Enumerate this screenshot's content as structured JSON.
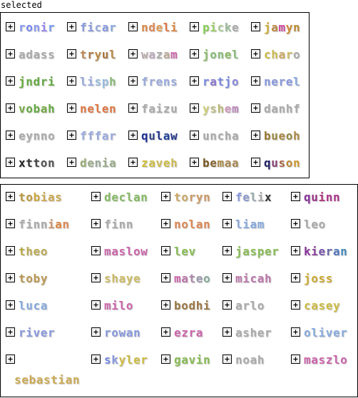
{
  "header": {
    "title": "selected"
  },
  "selected": [
    {
      "name": "ronir",
      "colors": [
        "#8899ee",
        "#7788ee",
        "#8899ee",
        "#9988ee",
        "#7799ee"
      ]
    },
    {
      "name": "ficar",
      "colors": [
        "#8899dd",
        "#8899dd",
        "#99aadd",
        "#8899dd",
        "#88aadd"
      ]
    },
    {
      "name": "ndeli",
      "colors": [
        "#dd8844",
        "#dd8855",
        "#dd9955",
        "#dd7744",
        "#dd8844"
      ]
    },
    {
      "name": "picke",
      "colors": [
        "#88cc55",
        "#99cc66",
        "#aacc99",
        "#99bb99",
        "#aaaaaa"
      ]
    },
    {
      "name": "jamyn",
      "colors": [
        "#ccaa33",
        "#bb8844",
        "#cc4499",
        "#cc8833",
        "#bb8833"
      ]
    },
    {
      "name": "adass",
      "colors": [
        "#aaaaaa",
        "#aaaaaa",
        "#aaaaaa",
        "#aaaaaa",
        "#aaaaaa"
      ]
    },
    {
      "name": "tryul",
      "colors": [
        "#bb8855",
        "#aa7744",
        "#bb8844",
        "#aa7744",
        "#bb8844"
      ]
    },
    {
      "name": "wazam",
      "colors": [
        "#bbaaaa",
        "#bbaabb",
        "#aaaaaa",
        "#bbaa99",
        "#cc66aa"
      ]
    },
    {
      "name": "jonel",
      "colors": [
        "#88bb66",
        "#88bb77",
        "#88bb77",
        "#88bb66",
        "#88bb77"
      ]
    },
    {
      "name": "charo",
      "colors": [
        "#ccbb44",
        "#ccbb55",
        "#ccaa66",
        "#ccbb66",
        "#aaaaaa"
      ]
    },
    {
      "name": "jndri",
      "colors": [
        "#66aa33",
        "#66aa44",
        "#66aa44",
        "#66aa44",
        "#66aa44"
      ]
    },
    {
      "name": "lisph",
      "colors": [
        "#99aadd",
        "#99aadd",
        "#99bbdd",
        "#99bbdd",
        "#88bb77"
      ]
    },
    {
      "name": "frens",
      "colors": [
        "#99aadd",
        "#99aadd",
        "#99aadd",
        "#99aadd",
        "#99aadd"
      ]
    },
    {
      "name": "ratjo",
      "colors": [
        "#7788dd",
        "#8877cc",
        "#7788dd",
        "#7788dd",
        "#8888dd"
      ]
    },
    {
      "name": "nerel",
      "colors": [
        "#8899dd",
        "#8899dd",
        "#8899dd",
        "#8899dd",
        "#88aadd"
      ]
    },
    {
      "name": "vobah",
      "colors": [
        "#77aa44",
        "#66aa44",
        "#66aa44",
        "#77aa44",
        "#66aa44"
      ]
    },
    {
      "name": "nelen",
      "colors": [
        "#dd7744",
        "#dd7744",
        "#dd7744",
        "#dd7744",
        "#dd7744"
      ]
    },
    {
      "name": "faizu",
      "colors": [
        "#aaaaaa",
        "#aaaaaa",
        "#aaaaaa",
        "#aaaaaa",
        "#aaaaaa"
      ]
    },
    {
      "name": "yshem",
      "colors": [
        "#cccc77",
        "#bbbb88",
        "#bbbb77",
        "#cc99bb",
        "#bb88bb"
      ]
    },
    {
      "name": "danhf",
      "colors": [
        "#aaaaaa",
        "#aaaaaa",
        "#aaaaaa",
        "#aaaaaa",
        "#aaaaaa"
      ]
    },
    {
      "name": "eynno",
      "colors": [
        "#aaaaaa",
        "#aaaaaa",
        "#aaaaaa",
        "#aaaaaa",
        "#aaaaaa"
      ]
    },
    {
      "name": "fffar",
      "colors": [
        "#99aadd",
        "#99aadd",
        "#99aadd",
        "#99aadd",
        "#99aadd"
      ]
    },
    {
      "name": "qulaw",
      "colors": [
        "#223399",
        "#334488",
        "#223388",
        "#224499",
        "#223388"
      ]
    },
    {
      "name": "uncha",
      "colors": [
        "#aaaaaa",
        "#aaaaaa",
        "#aaaaaa",
        "#aaaaaa",
        "#aaaaaa"
      ]
    },
    {
      "name": "bueoh",
      "colors": [
        "#997733",
        "#998844",
        "#aa8844",
        "#998844",
        "#aa8844"
      ]
    },
    {
      "name": "xtton",
      "colors": [
        "#222222",
        "#333333",
        "#444444",
        "#555555",
        "#555555"
      ]
    },
    {
      "name": "denia",
      "colors": [
        "#99aa77",
        "#99aa88",
        "#99aa99",
        "#99aa88",
        "#99aa88"
      ]
    },
    {
      "name": "zaveh",
      "colors": [
        "#ccbb33",
        "#ccbb44",
        "#ccbb55",
        "#ccbb44",
        "#ccbb55"
      ]
    },
    {
      "name": "bemaa",
      "colors": [
        "#775522",
        "#886633",
        "#aa8844",
        "#aa8855",
        "#aa8855"
      ]
    },
    {
      "name": "quson",
      "colors": [
        "#222266",
        "#884477",
        "#aa6644",
        "#bb8833",
        "#cc9933"
      ]
    }
  ],
  "available": [
    {
      "name": "tobias",
      "colors": [
        "#bb9944",
        "#bb9944",
        "#ccaa44",
        "#ccaa55",
        "#ccaa55",
        "#ccaa55"
      ]
    },
    {
      "name": "declan",
      "colors": [
        "#88bb66",
        "#88bb66",
        "#88bb66",
        "#88bb66",
        "#88bb66",
        "#88bb66"
      ]
    },
    {
      "name": "toryn",
      "colors": [
        "#ccaa66",
        "#ccaa66",
        "#cc9966",
        "#cc9966",
        "#cc9966"
      ]
    },
    {
      "name": "felix",
      "colors": [
        "#8899dd",
        "#8899cc",
        "#99aaaa",
        "#aaaaaa",
        "#333333"
      ]
    },
    {
      "name": "quinn",
      "colors": [
        "#883399",
        "#993388",
        "#aa3377",
        "#aa3388",
        "#aa3388"
      ]
    },
    {
      "name": "finnian",
      "colors": [
        "#aaaaaa",
        "#aaaaaa",
        "#aaaaaa",
        "#aaaaaa",
        "#cc9977",
        "#dd8844",
        "#dd8855"
      ]
    },
    {
      "name": "finn",
      "colors": [
        "#aaaaaa",
        "#aaaaaa",
        "#aaaaaa",
        "#aaaaaa"
      ]
    },
    {
      "name": "nolan",
      "colors": [
        "#dd8855",
        "#dd8855",
        "#dd8855",
        "#dd8855",
        "#dd8855"
      ]
    },
    {
      "name": "liam",
      "colors": [
        "#88aadd",
        "#88aadd",
        "#88aadd",
        "#88aadd"
      ]
    },
    {
      "name": "leo",
      "colors": [
        "#aaaaaa",
        "#aaaaaa",
        "#aaaaaa"
      ]
    },
    {
      "name": "theo",
      "colors": [
        "#bbaa44",
        "#bbaa55",
        "#bbaa55",
        "#bbaa55"
      ]
    },
    {
      "name": "maslow",
      "colors": [
        "#cc66aa",
        "#cc66aa",
        "#cc66aa",
        "#cc66aa",
        "#cc66aa",
        "#cc66aa"
      ]
    },
    {
      "name": "lev",
      "colors": [
        "#88bb55",
        "#88bb55",
        "#88bb55"
      ]
    },
    {
      "name": "jasper",
      "colors": [
        "#88bb55",
        "#88bb55",
        "#88bb55",
        "#88bb55",
        "#88bb55",
        "#88bb55"
      ]
    },
    {
      "name": "kieran",
      "colors": [
        "#883399",
        "#884499",
        "#7755aa",
        "#6666aa",
        "#5577bb",
        "#4488bb"
      ]
    },
    {
      "name": "toby",
      "colors": [
        "#bb9955",
        "#bb9955",
        "#bb9955",
        "#bb9955"
      ]
    },
    {
      "name": "shaye",
      "colors": [
        "#ccbb66",
        "#ccbb66",
        "#ccbb66",
        "#ccbb66",
        "#ccbb66"
      ]
    },
    {
      "name": "mateo",
      "colors": [
        "#cc66aa",
        "#bb77aa",
        "#aa88aa",
        "#9999aa",
        "#88aa99"
      ]
    },
    {
      "name": "micah",
      "colors": [
        "#bb77aa",
        "#bb77aa",
        "#bb77aa",
        "#bb77aa",
        "#bb77aa"
      ]
    },
    {
      "name": "joss",
      "colors": [
        "#ccaa33",
        "#ccaa33",
        "#ccaa33",
        "#ccaa33"
      ]
    },
    {
      "name": "luca",
      "colors": [
        "#88aadd",
        "#88aadd",
        "#88aadd",
        "#88aadd"
      ]
    },
    {
      "name": "milo",
      "colors": [
        "#cc66aa",
        "#cc66aa",
        "#cc66aa",
        "#cc66aa"
      ]
    },
    {
      "name": "bodhi",
      "colors": [
        "#997744",
        "#997744",
        "#997744",
        "#997744",
        "#997744"
      ]
    },
    {
      "name": "arlo",
      "colors": [
        "#aaaaaa",
        "#aaaaaa",
        "#aaaaaa",
        "#aaaaaa"
      ]
    },
    {
      "name": "casey",
      "colors": [
        "#ccbb44",
        "#ccbb44",
        "#ccbb44",
        "#ccbb44",
        "#ccbb44"
      ]
    },
    {
      "name": "river",
      "colors": [
        "#8899dd",
        "#8899dd",
        "#8899dd",
        "#8899dd",
        "#8899dd"
      ]
    },
    {
      "name": "rowan",
      "colors": [
        "#8899dd",
        "#8899dd",
        "#8899dd",
        "#8899dd",
        "#8899dd"
      ]
    },
    {
      "name": "ezra",
      "colors": [
        "#cc66aa",
        "#cc66aa",
        "#cc66aa",
        "#cc66aa"
      ]
    },
    {
      "name": "asher",
      "colors": [
        "#aaaaaa",
        "#aaaaaa",
        "#aaaaaa",
        "#aaaaaa",
        "#aaaaaa"
      ]
    },
    {
      "name": "oliver",
      "colors": [
        "#88aadd",
        "#88aadd",
        "#88aadd",
        "#88aadd",
        "#88aadd",
        "#88aadd"
      ]
    },
    {
      "name": "sebastian",
      "colors": [
        "#ccaa55",
        "#ccaa55",
        "#ccaa55",
        "#ccaa55",
        "#ccaa55",
        "#ccaa55",
        "#ccaa55",
        "#ccaa55",
        "#ccaa55"
      ]
    },
    {
      "name": "skyler",
      "colors": [
        "#7788dd",
        "#8899dd",
        "#ccbb44",
        "#ccbb44",
        "#ccbb44",
        "#ccbb44"
      ]
    },
    {
      "name": "gavin",
      "colors": [
        "#88bb55",
        "#88bb55",
        "#88bb55",
        "#88bb55",
        "#88bb55"
      ]
    },
    {
      "name": "noah",
      "colors": [
        "#aaaaaa",
        "#aaaaaa",
        "#aaaaaa",
        "#aaaaaa"
      ]
    },
    {
      "name": "maszlo",
      "colors": [
        "#cc66aa",
        "#cc66aa",
        "#cc66aa",
        "#cc66aa",
        "#cc66aa",
        "#cc66aa"
      ]
    }
  ]
}
